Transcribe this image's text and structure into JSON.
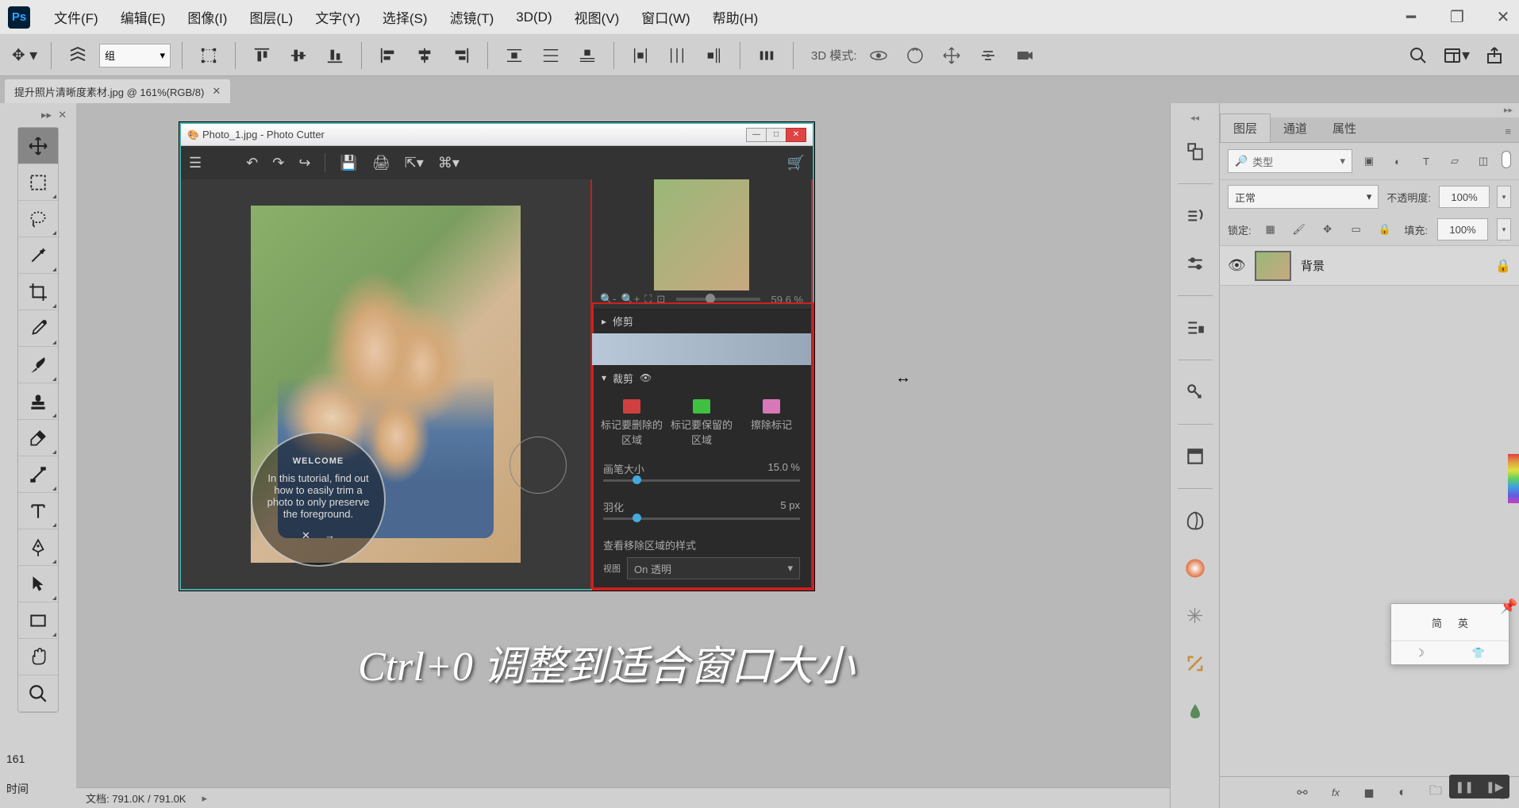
{
  "menubar": {
    "items": [
      "文件(F)",
      "编辑(E)",
      "图像(I)",
      "图层(L)",
      "文字(Y)",
      "选择(S)",
      "滤镜(T)",
      "3D(D)",
      "视图(V)",
      "窗口(W)",
      "帮助(H)"
    ]
  },
  "optbar": {
    "group_label": "组",
    "mode_3d_label": "3D 模式:"
  },
  "doc_tab": {
    "title": "提升照片清晰度素材.jpg @ 161%(RGB/8)"
  },
  "statusbar": {
    "zoom": "161",
    "doc_info": "文档: 791.0K / 791.0K"
  },
  "panels": {
    "tabs": [
      "图层",
      "通道",
      "属性"
    ],
    "filter_kind": "类型",
    "blend_mode": "正常",
    "opacity_label": "不透明度:",
    "opacity_value": "100%",
    "lock_label": "锁定:",
    "fill_label": "填充:",
    "fill_value": "100%"
  },
  "layers": [
    {
      "name": "背景",
      "locked": true,
      "visible": true
    }
  ],
  "photo_cutter": {
    "title": "Photo_1.jpg - Photo Cutter",
    "zoom_value": "59.6 %",
    "section_repair": "修剪",
    "section_crop": "裁剪",
    "tool_remove": "标记要删除的区域",
    "tool_keep": "标记要保留的区域",
    "tool_erase": "擦除标记",
    "brush_label": "画笔大小",
    "brush_value": "15.0 %",
    "feather_label": "羽化",
    "feather_value": "5 px",
    "view_section": "查看移除区域的样式",
    "view_label": "视图",
    "view_value": "On 透明",
    "welcome_title": "WELCOME",
    "welcome_text": "In this tutorial, find out how to easily trim a photo to only preserve the foreground."
  },
  "subtitle": "Ctrl+0  调整到适合窗口大小",
  "ime": {
    "opt1": "简",
    "opt2": "英"
  },
  "bottom_left_label": "时间"
}
